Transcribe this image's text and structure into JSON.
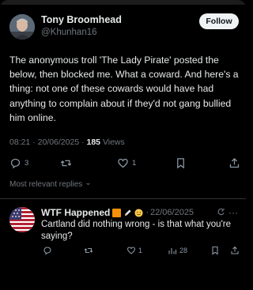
{
  "tweet": {
    "author_name": "Tony Broomhead",
    "author_handle": "@Khunhan16",
    "follow_label": "Follow",
    "text": "The anonymous troll 'The Lady Pirate' posted the below, then blocked me. What a coward. And here's a thing: not one of these cowards would have had anything to complain about if they'd not gang bullied him online.",
    "timestamp": "08:21 · 20/06/2025 · ",
    "views_count": "185",
    "views_label": " Views",
    "replies_count": "3",
    "reposts_count": "",
    "likes_count": "1"
  },
  "replies_filter": {
    "label": "Most relevant replies",
    "chevron": "⌄"
  },
  "reply": {
    "author_name": "WTF Happened",
    "separator": "·",
    "date": "22/06/2025",
    "more": "···",
    "text": "Cartland did nothing wrong - is that what you're saying?",
    "likes_count": "1",
    "views_count": "28"
  },
  "icons": {
    "reply": "reply-icon",
    "repost": "repost-icon",
    "like": "heart-icon",
    "bookmark": "bookmark-icon",
    "share": "share-icon",
    "views": "views-icon"
  },
  "colors": {
    "background": "#000000",
    "text": "#e7e9ea",
    "muted": "#71767b",
    "follow_bg": "#eff3f4",
    "divider": "#2f3336"
  }
}
